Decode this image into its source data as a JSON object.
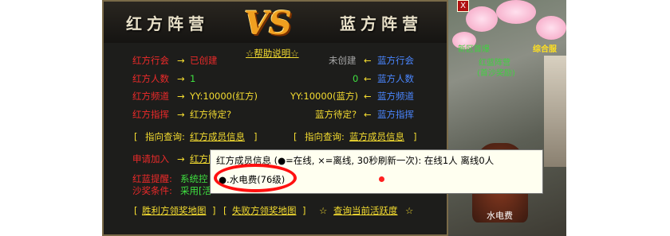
{
  "header": {
    "red_title": "红方阵营",
    "blue_title": "蓝方阵营",
    "vs": "VS",
    "help_link": "☆帮助说明☆"
  },
  "rows": [
    {
      "red_label": "红方行会",
      "red_value": "已创建",
      "blue_value": "未创建",
      "blue_label": "蓝方行会"
    },
    {
      "red_label": "红方人数",
      "red_value": "1",
      "blue_value": "0",
      "blue_label": "蓝方人数"
    },
    {
      "red_label": "红方频道",
      "red_value": "YY:10000(红方)",
      "blue_value": "YY:10000(蓝方)",
      "blue_label": "蓝方频道"
    },
    {
      "red_label": "红方指挥",
      "red_value": "红方待定?",
      "blue_value": "蓝方待定?",
      "blue_label": "蓝方指挥"
    }
  ],
  "arrow_right": "→",
  "arrow_left": "←",
  "query": {
    "red_prefix": "指向查询:",
    "red_link": "红方成员信息",
    "blue_prefix": "指向查询:",
    "blue_link": "蓝方成员信息",
    "bracket_open": "[",
    "bracket_close": "]"
  },
  "join": {
    "label": "申请加入",
    "link": "红方阵"
  },
  "notice": {
    "label1": "红蓝提醒:",
    "text1": "系统控",
    "label2": "沙奖条件:",
    "text2": "采用[活"
  },
  "bottom": {
    "link1": "胜利方领奖地图",
    "link2": "失败方领奖地图",
    "star": "☆",
    "link3": "查询当前活跃度"
  },
  "tooltip": {
    "line1": "红方成员信息 (●=在线, ×=离线, 30秒刷新一次):   在线1人   离线0人",
    "member": "●.水电费(76级)"
  },
  "game": {
    "map_label1": "新区首爆",
    "map_label2": "综合服",
    "npc1": "红蓝阵营",
    "npc2": "(首沙奖励)",
    "player_name": "水电费",
    "close": "X"
  }
}
